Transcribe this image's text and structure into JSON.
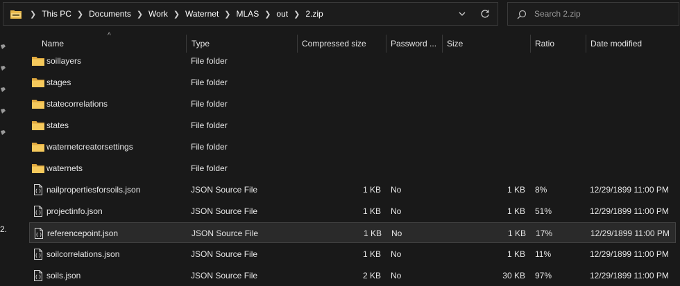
{
  "address": {
    "breadcrumbs": [
      "This PC",
      "Documents",
      "Work",
      "Waternet",
      "MLAS",
      "out",
      "2.zip"
    ]
  },
  "search": {
    "placeholder": "Search 2.zip"
  },
  "nav": {
    "stub_text": "2."
  },
  "columns": {
    "name": "Name",
    "type": "Type",
    "compressed": "Compressed size",
    "password": "Password ...",
    "size": "Size",
    "ratio": "Ratio",
    "date": "Date modified"
  },
  "rows": [
    {
      "name": "soillayers",
      "icon": "folder-icon",
      "type": "File folder",
      "compressed": "",
      "password": "",
      "size": "",
      "ratio": "",
      "date": ""
    },
    {
      "name": "stages",
      "icon": "folder-icon",
      "type": "File folder",
      "compressed": "",
      "password": "",
      "size": "",
      "ratio": "",
      "date": ""
    },
    {
      "name": "statecorrelations",
      "icon": "folder-icon",
      "type": "File folder",
      "compressed": "",
      "password": "",
      "size": "",
      "ratio": "",
      "date": ""
    },
    {
      "name": "states",
      "icon": "folder-icon",
      "type": "File folder",
      "compressed": "",
      "password": "",
      "size": "",
      "ratio": "",
      "date": ""
    },
    {
      "name": "waternetcreatorsettings",
      "icon": "folder-icon",
      "type": "File folder",
      "compressed": "",
      "password": "",
      "size": "",
      "ratio": "",
      "date": ""
    },
    {
      "name": "waternets",
      "icon": "folder-icon",
      "type": "File folder",
      "compressed": "",
      "password": "",
      "size": "",
      "ratio": "",
      "date": ""
    },
    {
      "name": "nailpropertiesforsoils.json",
      "icon": "json-file-icon",
      "type": "JSON Source File",
      "compressed": "1 KB",
      "password": "No",
      "size": "1 KB",
      "ratio": "8%",
      "date": "12/29/1899 11:00 PM"
    },
    {
      "name": "projectinfo.json",
      "icon": "json-file-icon",
      "type": "JSON Source File",
      "compressed": "1 KB",
      "password": "No",
      "size": "1 KB",
      "ratio": "51%",
      "date": "12/29/1899 11:00 PM"
    },
    {
      "name": "referencepoint.json",
      "icon": "json-file-icon",
      "type": "JSON Source File",
      "compressed": "1 KB",
      "password": "No",
      "size": "1 KB",
      "ratio": "17%",
      "date": "12/29/1899 11:00 PM",
      "selected": true
    },
    {
      "name": "soilcorrelations.json",
      "icon": "json-file-icon",
      "type": "JSON Source File",
      "compressed": "1 KB",
      "password": "No",
      "size": "1 KB",
      "ratio": "11%",
      "date": "12/29/1899 11:00 PM"
    },
    {
      "name": "soils.json",
      "icon": "json-file-icon",
      "type": "JSON Source File",
      "compressed": "2 KB",
      "password": "No",
      "size": "30 KB",
      "ratio": "97%",
      "date": "12/29/1899 11:00 PM"
    }
  ],
  "colors": {
    "background": "#191919",
    "folder": "#f2c55c",
    "selected_row": "#2a2a2a",
    "text": "#e6e6e6"
  }
}
